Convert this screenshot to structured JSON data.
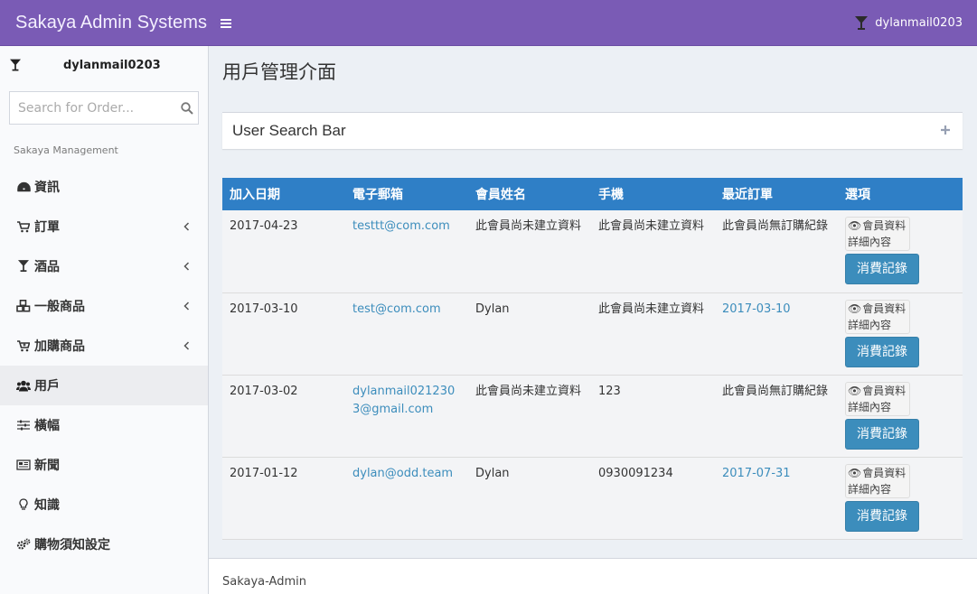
{
  "header": {
    "brand": "Sakaya Admin Systems",
    "username": "dylanmail0203",
    "color": "#7a5bb5"
  },
  "sidebar": {
    "username": "dylanmail0203",
    "search_placeholder": "Search for Order...",
    "section_header": "Sakaya Management",
    "items": [
      {
        "label": "資訊",
        "icon": "dashboard-icon",
        "has_chevron": false
      },
      {
        "label": "訂單",
        "icon": "cart-icon",
        "has_chevron": true
      },
      {
        "label": "酒品",
        "icon": "glass-icon",
        "has_chevron": true
      },
      {
        "label": "一般商品",
        "icon": "cubes-icon",
        "has_chevron": true
      },
      {
        "label": "加購商品",
        "icon": "cart-plus-icon",
        "has_chevron": true
      },
      {
        "label": "用戶",
        "icon": "users-icon",
        "has_chevron": false,
        "active": true
      },
      {
        "label": "橫幅",
        "icon": "sliders-icon",
        "has_chevron": false
      },
      {
        "label": "新聞",
        "icon": "newspaper-icon",
        "has_chevron": false
      },
      {
        "label": "知識",
        "icon": "lightbulb-icon",
        "has_chevron": false
      },
      {
        "label": "購物須知設定",
        "icon": "gears-icon",
        "has_chevron": false
      }
    ]
  },
  "main": {
    "title": "用戶管理介面",
    "search_box_title": "User Search Bar",
    "table": {
      "headers": [
        "加入日期",
        "電子郵箱",
        "會員姓名",
        "手機",
        "最近訂單",
        "選項"
      ],
      "rows": [
        {
          "date": "2017-04-23",
          "email": "testtt@com.com",
          "name": "此會員尚未建立資料",
          "phone": "此會員尚未建立資料",
          "last_order": "此會員尚無訂購紀錄",
          "last_order_link": false
        },
        {
          "date": "2017-03-10",
          "email": "test@com.com",
          "name": "Dylan",
          "phone": "此會員尚未建立資料",
          "last_order": "2017-03-10",
          "last_order_link": true
        },
        {
          "date": "2017-03-02",
          "email": "dylanmail0212303@gmail.com",
          "name": "此會員尚未建立資料",
          "phone": "123",
          "last_order": "此會員尚無訂購紀錄",
          "last_order_link": false
        },
        {
          "date": "2017-01-12",
          "email": "dylan@odd.team",
          "name": "Dylan",
          "phone": "0930091234",
          "last_order": "2017-07-31",
          "last_order_link": true
        }
      ],
      "info_button_label": "會員資料詳細內容",
      "consume_button_label": "消費記錄"
    }
  },
  "footer": {
    "text": "Sakaya-Admin"
  }
}
